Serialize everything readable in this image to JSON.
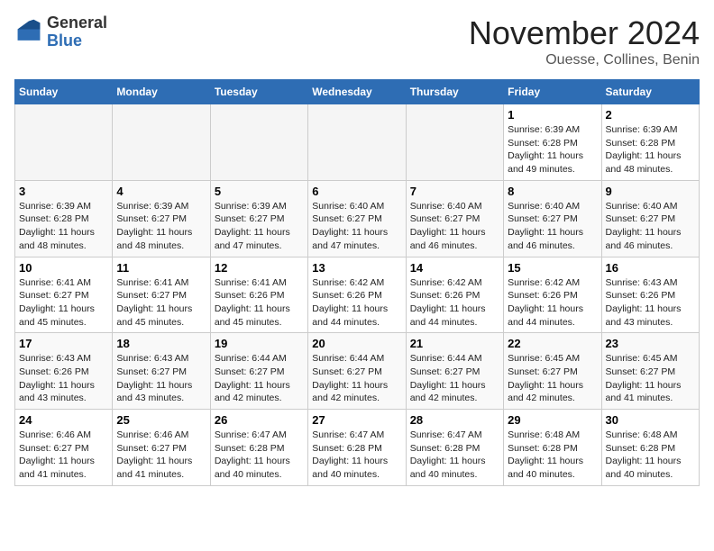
{
  "logo": {
    "general": "General",
    "blue": "Blue"
  },
  "header": {
    "month": "November 2024",
    "location": "Ouesse, Collines, Benin"
  },
  "days_of_week": [
    "Sunday",
    "Monday",
    "Tuesday",
    "Wednesday",
    "Thursday",
    "Friday",
    "Saturday"
  ],
  "weeks": [
    [
      {
        "day": "",
        "info": ""
      },
      {
        "day": "",
        "info": ""
      },
      {
        "day": "",
        "info": ""
      },
      {
        "day": "",
        "info": ""
      },
      {
        "day": "",
        "info": ""
      },
      {
        "day": "1",
        "info": "Sunrise: 6:39 AM\nSunset: 6:28 PM\nDaylight: 11 hours and 49 minutes."
      },
      {
        "day": "2",
        "info": "Sunrise: 6:39 AM\nSunset: 6:28 PM\nDaylight: 11 hours and 48 minutes."
      }
    ],
    [
      {
        "day": "3",
        "info": "Sunrise: 6:39 AM\nSunset: 6:28 PM\nDaylight: 11 hours and 48 minutes."
      },
      {
        "day": "4",
        "info": "Sunrise: 6:39 AM\nSunset: 6:27 PM\nDaylight: 11 hours and 48 minutes."
      },
      {
        "day": "5",
        "info": "Sunrise: 6:39 AM\nSunset: 6:27 PM\nDaylight: 11 hours and 47 minutes."
      },
      {
        "day": "6",
        "info": "Sunrise: 6:40 AM\nSunset: 6:27 PM\nDaylight: 11 hours and 47 minutes."
      },
      {
        "day": "7",
        "info": "Sunrise: 6:40 AM\nSunset: 6:27 PM\nDaylight: 11 hours and 46 minutes."
      },
      {
        "day": "8",
        "info": "Sunrise: 6:40 AM\nSunset: 6:27 PM\nDaylight: 11 hours and 46 minutes."
      },
      {
        "day": "9",
        "info": "Sunrise: 6:40 AM\nSunset: 6:27 PM\nDaylight: 11 hours and 46 minutes."
      }
    ],
    [
      {
        "day": "10",
        "info": "Sunrise: 6:41 AM\nSunset: 6:27 PM\nDaylight: 11 hours and 45 minutes."
      },
      {
        "day": "11",
        "info": "Sunrise: 6:41 AM\nSunset: 6:27 PM\nDaylight: 11 hours and 45 minutes."
      },
      {
        "day": "12",
        "info": "Sunrise: 6:41 AM\nSunset: 6:26 PM\nDaylight: 11 hours and 45 minutes."
      },
      {
        "day": "13",
        "info": "Sunrise: 6:42 AM\nSunset: 6:26 PM\nDaylight: 11 hours and 44 minutes."
      },
      {
        "day": "14",
        "info": "Sunrise: 6:42 AM\nSunset: 6:26 PM\nDaylight: 11 hours and 44 minutes."
      },
      {
        "day": "15",
        "info": "Sunrise: 6:42 AM\nSunset: 6:26 PM\nDaylight: 11 hours and 44 minutes."
      },
      {
        "day": "16",
        "info": "Sunrise: 6:43 AM\nSunset: 6:26 PM\nDaylight: 11 hours and 43 minutes."
      }
    ],
    [
      {
        "day": "17",
        "info": "Sunrise: 6:43 AM\nSunset: 6:26 PM\nDaylight: 11 hours and 43 minutes."
      },
      {
        "day": "18",
        "info": "Sunrise: 6:43 AM\nSunset: 6:27 PM\nDaylight: 11 hours and 43 minutes."
      },
      {
        "day": "19",
        "info": "Sunrise: 6:44 AM\nSunset: 6:27 PM\nDaylight: 11 hours and 42 minutes."
      },
      {
        "day": "20",
        "info": "Sunrise: 6:44 AM\nSunset: 6:27 PM\nDaylight: 11 hours and 42 minutes."
      },
      {
        "day": "21",
        "info": "Sunrise: 6:44 AM\nSunset: 6:27 PM\nDaylight: 11 hours and 42 minutes."
      },
      {
        "day": "22",
        "info": "Sunrise: 6:45 AM\nSunset: 6:27 PM\nDaylight: 11 hours and 42 minutes."
      },
      {
        "day": "23",
        "info": "Sunrise: 6:45 AM\nSunset: 6:27 PM\nDaylight: 11 hours and 41 minutes."
      }
    ],
    [
      {
        "day": "24",
        "info": "Sunrise: 6:46 AM\nSunset: 6:27 PM\nDaylight: 11 hours and 41 minutes."
      },
      {
        "day": "25",
        "info": "Sunrise: 6:46 AM\nSunset: 6:27 PM\nDaylight: 11 hours and 41 minutes."
      },
      {
        "day": "26",
        "info": "Sunrise: 6:47 AM\nSunset: 6:28 PM\nDaylight: 11 hours and 40 minutes."
      },
      {
        "day": "27",
        "info": "Sunrise: 6:47 AM\nSunset: 6:28 PM\nDaylight: 11 hours and 40 minutes."
      },
      {
        "day": "28",
        "info": "Sunrise: 6:47 AM\nSunset: 6:28 PM\nDaylight: 11 hours and 40 minutes."
      },
      {
        "day": "29",
        "info": "Sunrise: 6:48 AM\nSunset: 6:28 PM\nDaylight: 11 hours and 40 minutes."
      },
      {
        "day": "30",
        "info": "Sunrise: 6:48 AM\nSunset: 6:28 PM\nDaylight: 11 hours and 40 minutes."
      }
    ]
  ]
}
